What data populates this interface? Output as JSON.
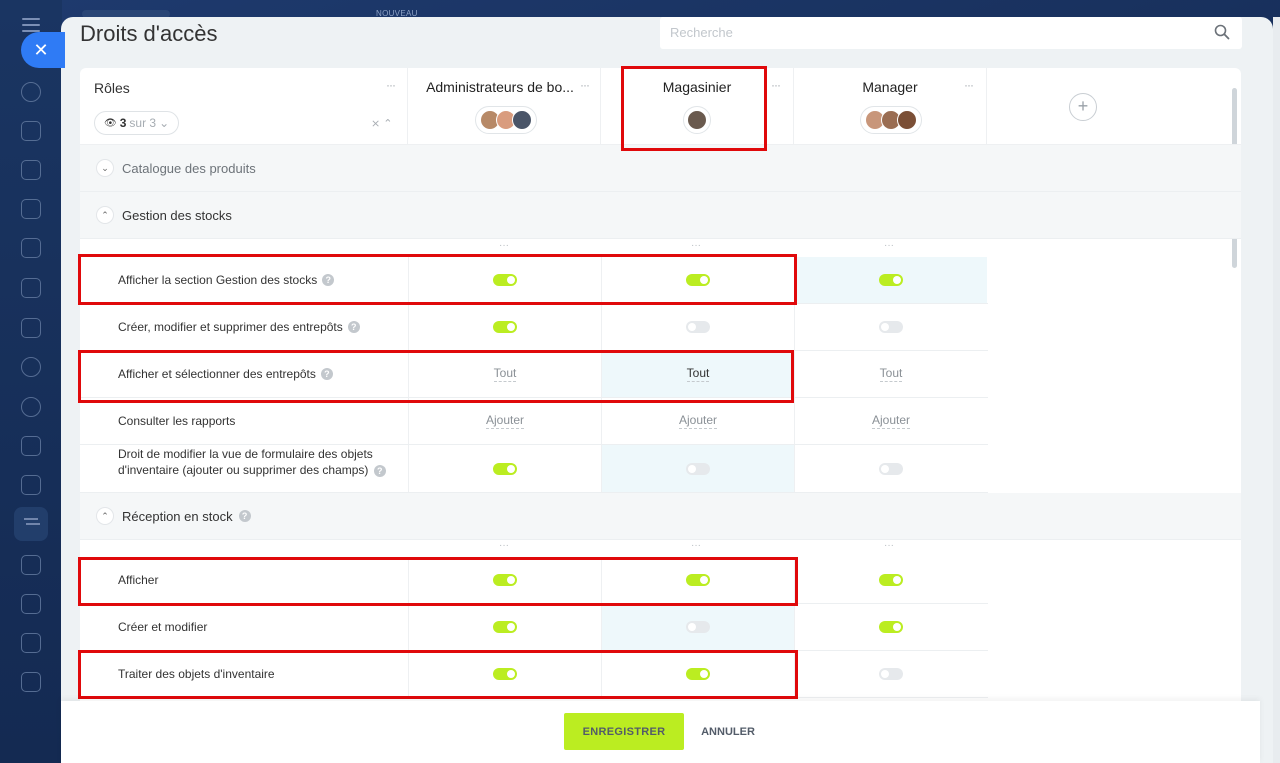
{
  "header": {
    "title": "Droits d'accès",
    "nouveau_badge": "NOUVEAU"
  },
  "search": {
    "placeholder": "Recherche"
  },
  "roles_column": {
    "title": "Rôles",
    "count_value": "3",
    "count_suffix": "sur 3",
    "menu": "···"
  },
  "roles": [
    {
      "name": "Administrateurs de bo...",
      "menu": "···"
    },
    {
      "name": "Magasinier",
      "menu": "···"
    },
    {
      "name": "Manager",
      "menu": "···"
    }
  ],
  "add_role_label": "+",
  "sections": [
    {
      "title": "Catalogue des produits",
      "chevron": "⌄"
    },
    {
      "title": "Gestion des stocks",
      "chevron": "⌃"
    },
    {
      "title": "Réception en stock",
      "chevron": "⌃",
      "help": "?"
    }
  ],
  "rows": [
    {
      "label": "Afficher la section Gestion des stocks",
      "help": "?",
      "values": [
        "on",
        "on",
        "on"
      ]
    },
    {
      "label": "Créer, modifier et supprimer des entrepôts",
      "help": "?",
      "values": [
        "on",
        "off",
        "off"
      ]
    },
    {
      "label": "Afficher et sélectionner des entrepôts",
      "help": "?",
      "values": [
        "Tout",
        "Tout",
        "Tout"
      ]
    },
    {
      "label": "Consulter les rapports",
      "values": [
        "Ajouter",
        "Ajouter",
        "Ajouter"
      ]
    },
    {
      "label": "Droit de modifier la vue de formulaire des objets d'inventaire (ajouter ou supprimer des champs)",
      "help": "?",
      "values": [
        "on",
        "off",
        "off"
      ]
    },
    {
      "label": "Afficher",
      "values": [
        "on",
        "on",
        "on"
      ]
    },
    {
      "label": "Créer et modifier",
      "values": [
        "on",
        "off",
        "on"
      ]
    },
    {
      "label": "Traiter des objets d'inventaire",
      "values": [
        "on",
        "on",
        "off"
      ]
    }
  ],
  "dots_label": "···",
  "footer": {
    "save": "ENREGISTRER",
    "cancel": "ANNULER"
  },
  "colors": {
    "accent_green": "#bbed21",
    "highlight_red": "#e0090b",
    "primary_blue": "#2f7bf5"
  }
}
